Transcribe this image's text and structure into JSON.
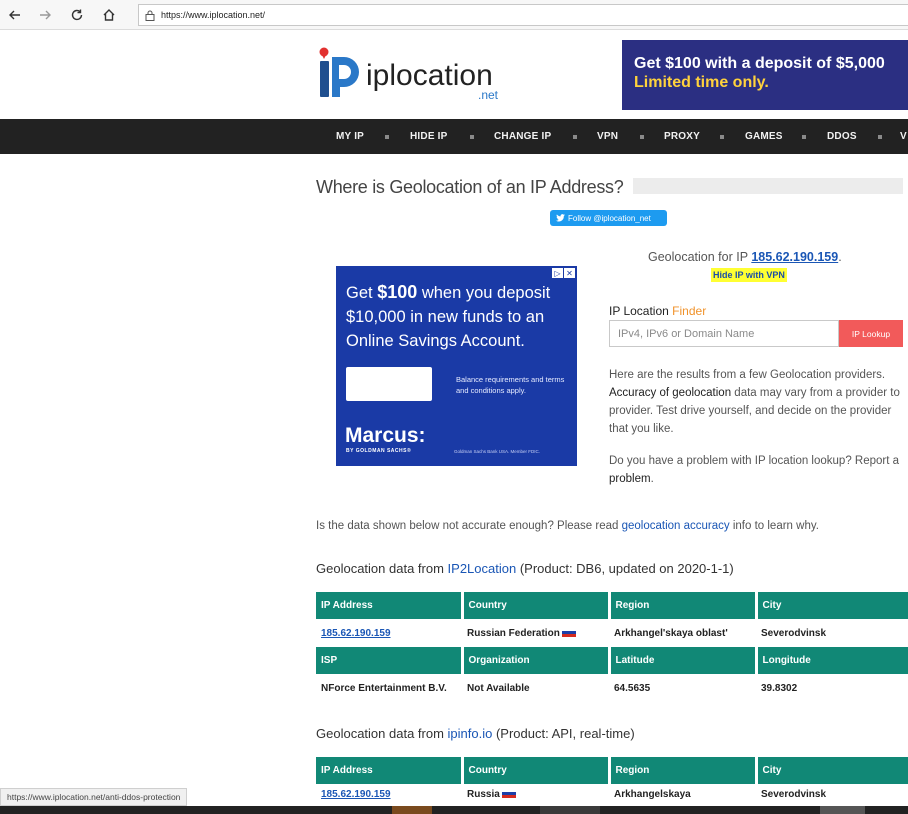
{
  "browser": {
    "url": "https://www.iplocation.net/"
  },
  "header": {
    "logo_text": "iplocation",
    "logo_suffix": ".net",
    "banner_line1": "Get $100 with a deposit of $5,000",
    "banner_line2": "Limited time only."
  },
  "nav": {
    "items": [
      "MY IP",
      "HIDE IP",
      "CHANGE IP",
      "VPN",
      "PROXY",
      "GAMES",
      "DDOS",
      "V"
    ]
  },
  "page": {
    "title": "Where is Geolocation of an IP Address?",
    "follow_label": "Follow @iplocation_net"
  },
  "ad": {
    "text_pre": "Get ",
    "text_amount": "$100",
    "text_post": " when you deposit $10,000 in new funds to an Online Savings Account.",
    "note": "Balance requirements and terms and conditions apply.",
    "brand": "Marcus:",
    "brand_sub": "BY GOLDMAN SACHS®",
    "legal": "Goldman Sachs Bank USA. Member FDIC."
  },
  "lookup": {
    "geo_prefix": "Geolocation for IP ",
    "ip": "185.62.190.159",
    "geo_suffix": ".",
    "hide_ip_label": "Hide IP with VPN",
    "finder_label": "IP Location ",
    "finder_accent": "Finder",
    "input_placeholder": "IPv4, IPv6 or Domain Name",
    "button_label": "IP Lookup"
  },
  "info": {
    "p1_start": "Here are the results from a few Geolocation providers. ",
    "p1_dark": "Accuracy of geolocation",
    "p1_end": " data may vary from a provider to provider. Test drive yourself, and decide on the provider that you like.",
    "p2_start": "Do you have a problem with IP location lookup? Report a ",
    "p2_link": "problem",
    "p2_end": ".",
    "accuracy_pre": "Is the data shown below not accurate enough? Please read ",
    "accuracy_link": "geolocation accuracy",
    "accuracy_post": " info to learn why."
  },
  "sections": [
    {
      "heading_pre": "Geolocation data from ",
      "provider": "IP2Location",
      "heading_post": " (Product: DB6, updated on 2020-1-1)",
      "row1_headers": [
        "IP Address",
        "Country",
        "Region",
        "City"
      ],
      "row1_values": [
        "185.62.190.159",
        "Russian Federation",
        "Arkhangel'skaya oblast'",
        "Severodvinsk"
      ],
      "row2_headers": [
        "ISP",
        "Organization",
        "Latitude",
        "Longitude"
      ],
      "row2_values": [
        "NForce Entertainment B.V.",
        "Not Available",
        "64.5635",
        "39.8302"
      ]
    },
    {
      "heading_pre": "Geolocation data from ",
      "provider": "ipinfo.io",
      "heading_post": " (Product: API, real-time)",
      "row1_headers": [
        "IP Address",
        "Country",
        "Region",
        "City"
      ],
      "row1_values": [
        "185.62.190.159",
        "Russia",
        "Arkhangelskaya",
        "Severodvinsk"
      ]
    }
  ],
  "status_url": "https://www.iplocation.net/anti-ddos-protection",
  "colors": {
    "nav_bg": "#222222",
    "table_header": "#118876",
    "link": "#1a56b5",
    "lookup_button": "#f25a5a",
    "ad_bg": "#1a3aa6",
    "banner_bg": "#2b2f82",
    "banner_accent": "#ffd23c"
  }
}
